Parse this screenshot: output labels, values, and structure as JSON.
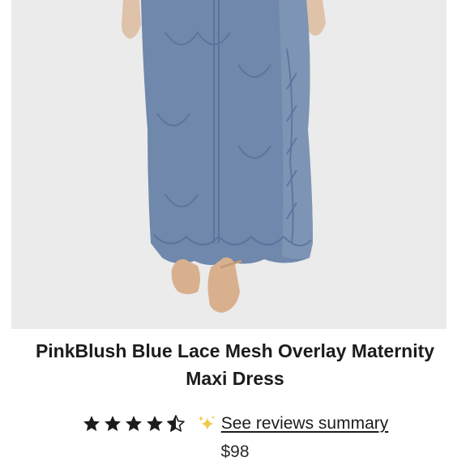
{
  "product": {
    "image_alt": "Blue lace mesh overlay maxi dress",
    "title_line1": "PinkBlush Blue Lace Mesh Overlay Maternity",
    "title_line2": "Maxi Dress",
    "rating": 4.5,
    "rating_max": 5,
    "reviews_link": "See reviews summary",
    "price": "$98"
  },
  "colors": {
    "dress": "#6f88ac",
    "dress_dark": "#57709a",
    "shoe": "#d9b08e",
    "skin": "#dfc2aa",
    "background": "#ebebeb",
    "star": "#1c1c1c",
    "sparkle": "#f2c94c"
  },
  "icons": {
    "star_full": "star-full-icon",
    "star_half": "star-half-icon",
    "sparkle": "sparkle-icon"
  }
}
